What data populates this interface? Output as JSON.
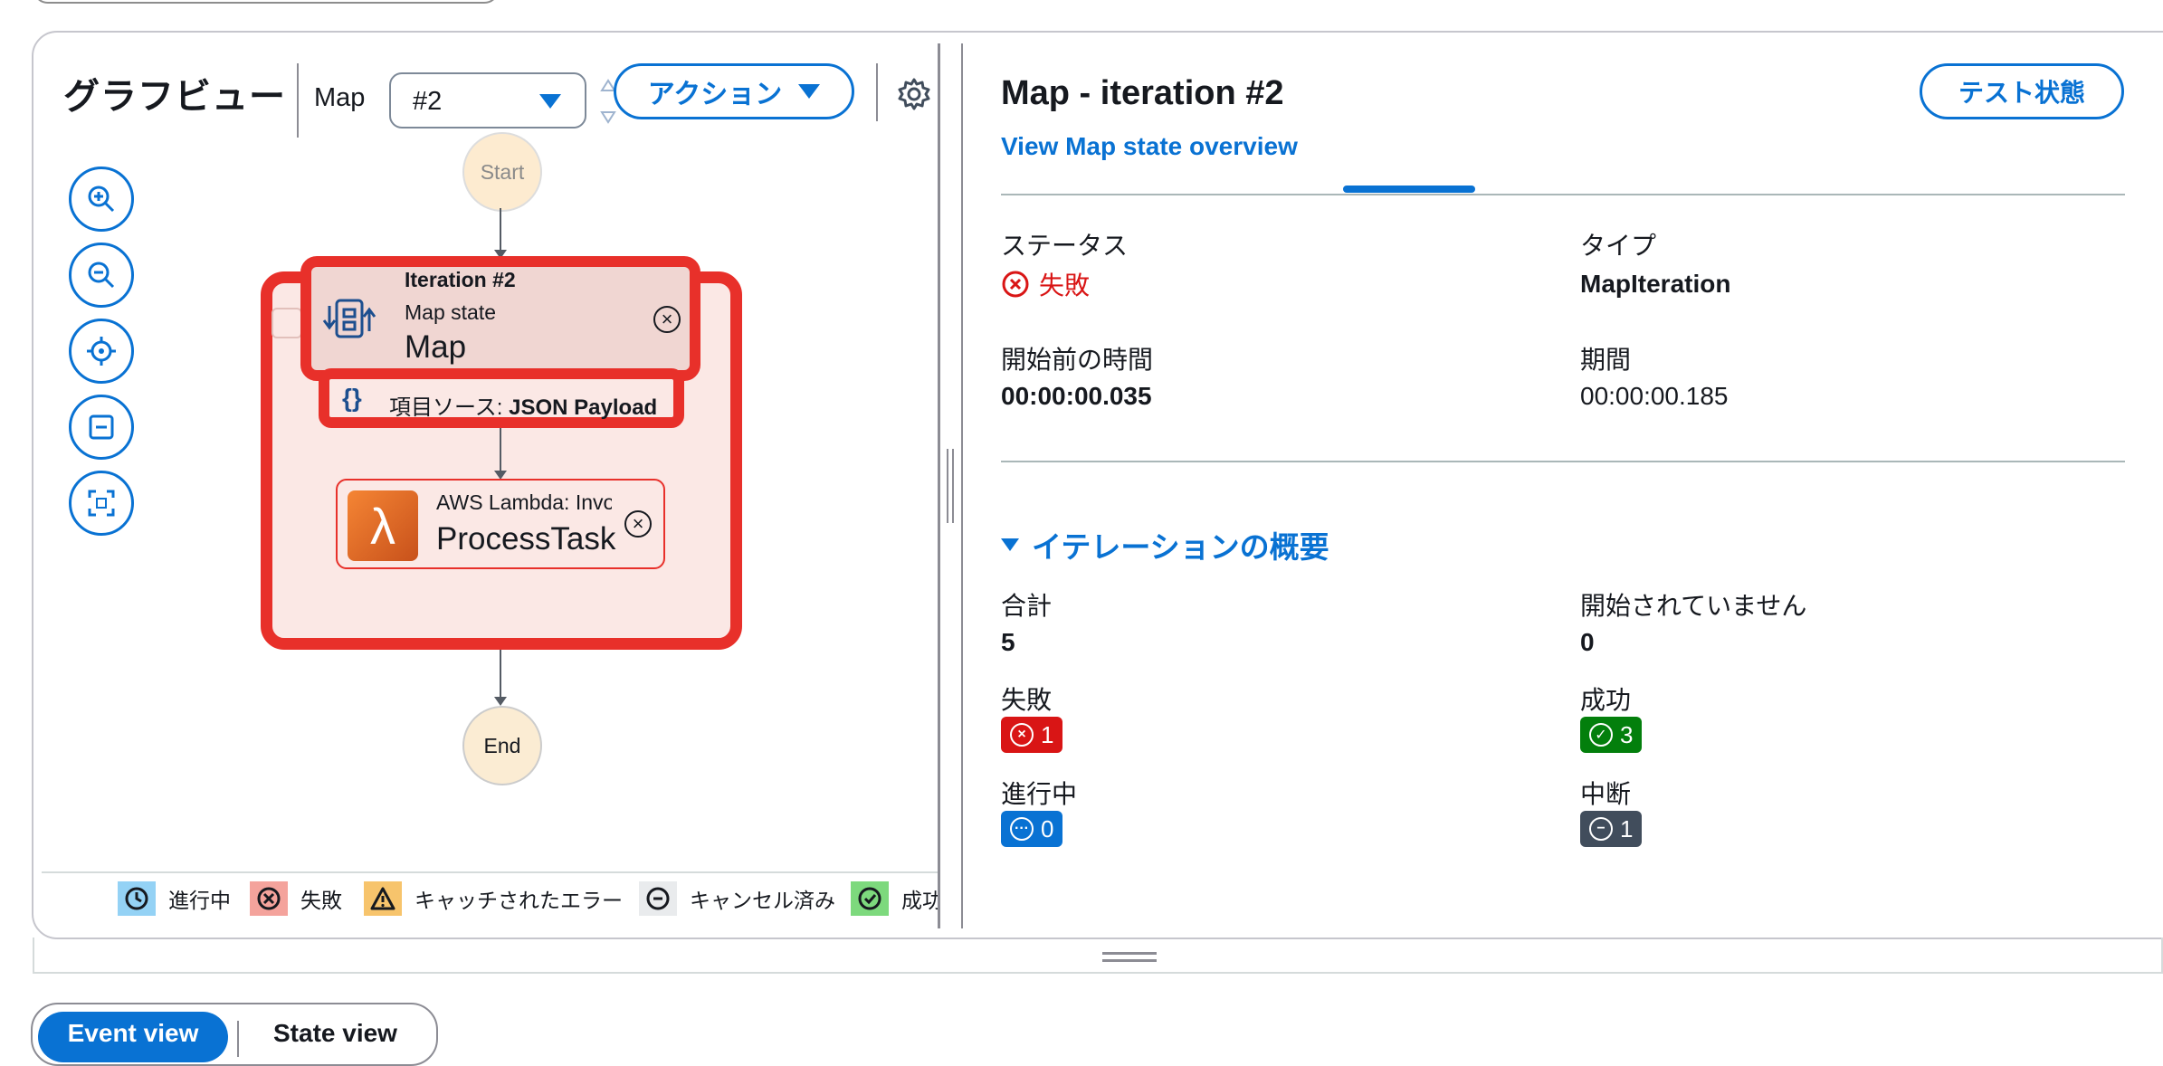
{
  "graph": {
    "title": "グラフビュー",
    "map_label": "Map",
    "iteration_select": "#2",
    "action_button": "アクション",
    "nodes": {
      "start": "Start",
      "end": "End",
      "iteration_title": "Iteration #2",
      "iteration_type": "Map state",
      "iteration_name": "Map",
      "item_source_label": "項目ソース: ",
      "item_source_value": "JSON Payload",
      "lambda_type": "AWS Lambda: Invoke",
      "lambda_name": "ProcessTask"
    },
    "legend": [
      {
        "label": "進行中",
        "color": "#94d2f5",
        "icon": "clock-icon"
      },
      {
        "label": "失敗",
        "color": "#f4a39c",
        "icon": "x-circle-icon"
      },
      {
        "label": "キャッチされたエラー",
        "color": "#f7c46c",
        "icon": "warning-icon"
      },
      {
        "label": "キャンセル済み",
        "color": "#e9ebed",
        "icon": "minus-circle-icon"
      },
      {
        "label": "成功",
        "color": "#7dd97d",
        "icon": "check-circle-icon"
      }
    ]
  },
  "details": {
    "title": "Map - iteration #2",
    "test_button": "テスト状態",
    "overview_link": "View Map state overview",
    "status_label": "ステータス",
    "status_value": "失敗",
    "type_label": "タイプ",
    "type_value": "MapIteration",
    "start_time_label": "開始前の時間",
    "start_time_value": "00:00:00.035",
    "duration_label": "期間",
    "duration_value": "00:00:00.185",
    "section_title": "イテレーションの概要",
    "total_label": "合計",
    "total_value": "5",
    "not_started_label": "開始されていません",
    "not_started_value": "0",
    "failed_label": "失敗",
    "failed_value": "1",
    "succeeded_label": "成功",
    "succeeded_value": "3",
    "running_label": "進行中",
    "running_value": "0",
    "aborted_label": "中断",
    "aborted_value": "1",
    "colors": {
      "failed": "#d91515",
      "succeeded": "#037f0c",
      "running": "#0972d3",
      "aborted": "#414d5c"
    }
  },
  "bottom": {
    "event_view": "Event view",
    "state_view": "State view"
  }
}
